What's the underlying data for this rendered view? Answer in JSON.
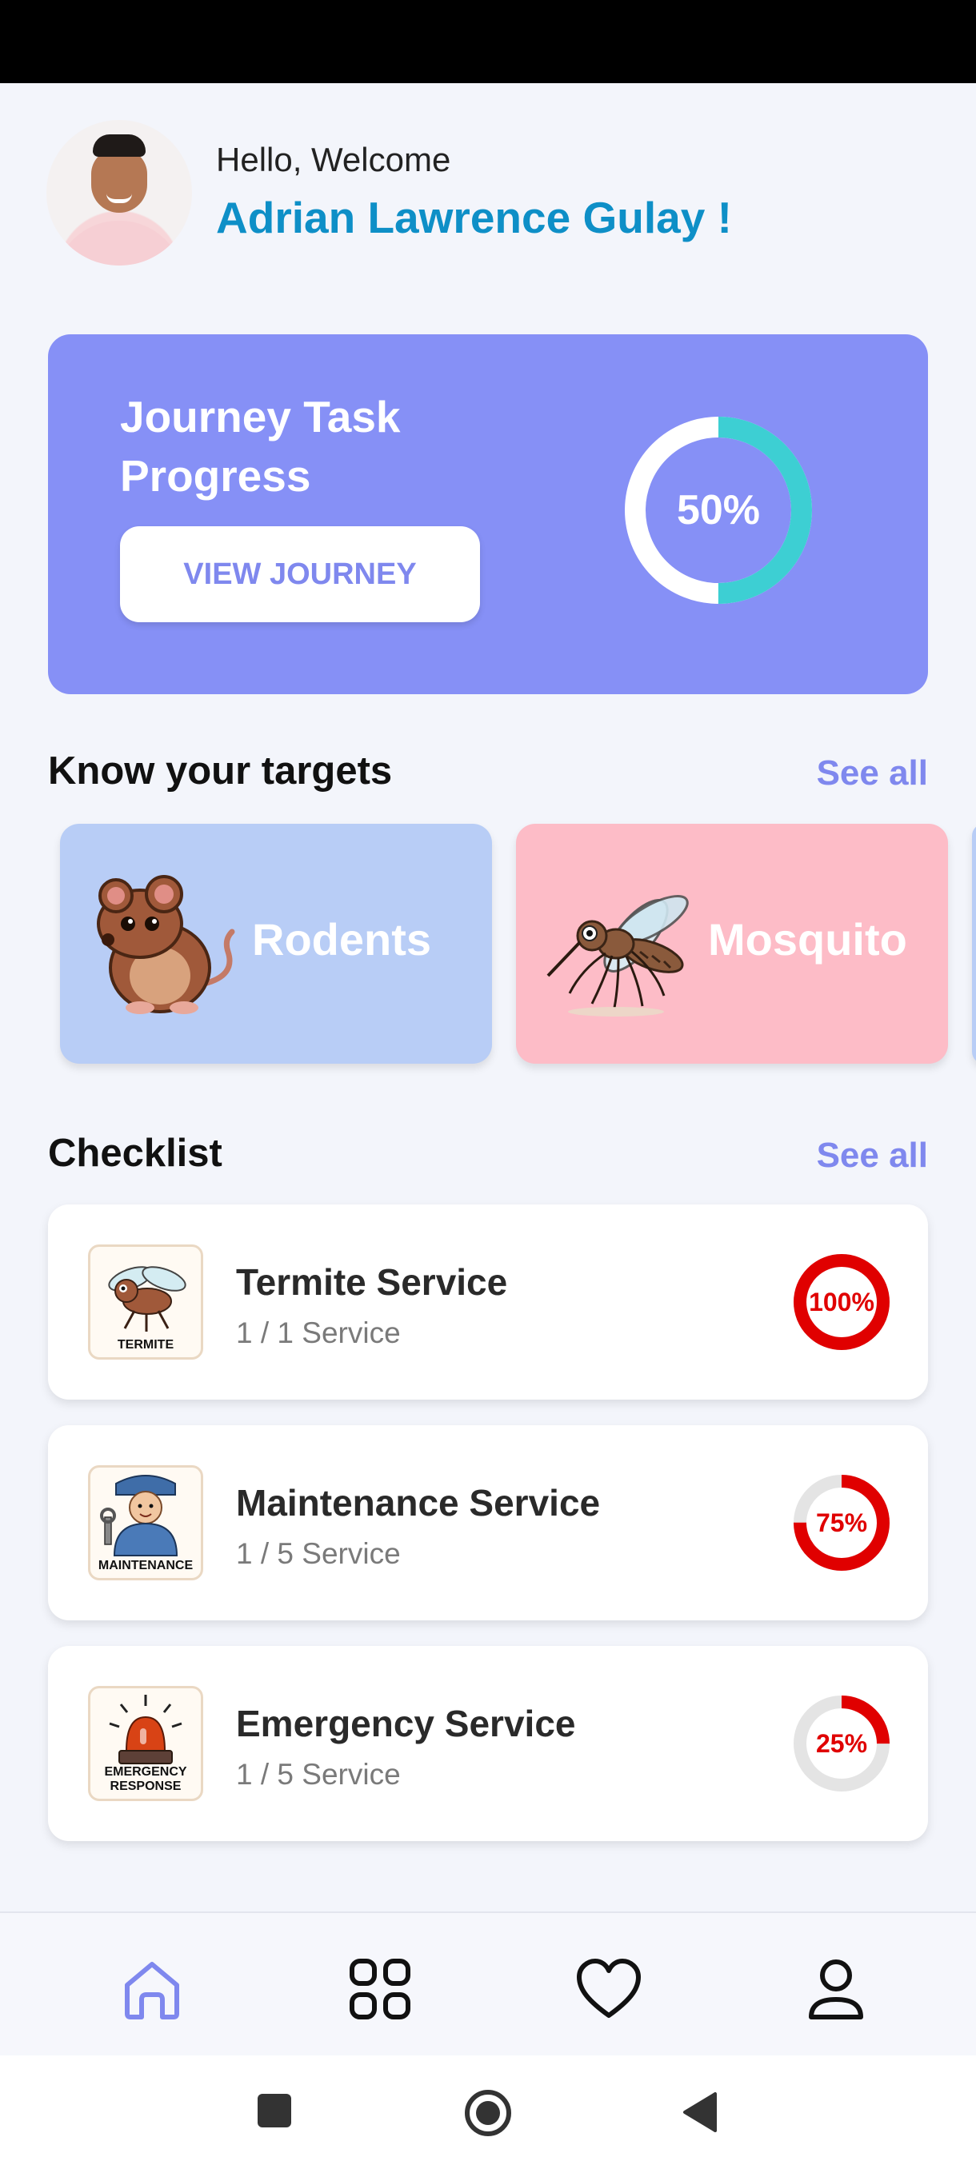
{
  "header": {
    "greeting": "Hello, Welcome",
    "user_name": "Adrian Lawrence Gulay !"
  },
  "journey": {
    "title": "Journey Task Progress",
    "button_label": "VIEW JOURNEY",
    "progress_label": "50%",
    "progress": 0.5
  },
  "targets": {
    "title": "Know your targets",
    "see_all": "See all",
    "items": [
      {
        "label": "Rodents",
        "icon": "rodent-icon"
      },
      {
        "label": "Mosquito",
        "icon": "mosquito-icon"
      }
    ]
  },
  "checklist": {
    "title": "Checklist",
    "see_all": "See all",
    "items": [
      {
        "name": "Termite Service",
        "sub": "1 / 1 Service",
        "percent_label": "100%",
        "progress": 1.0,
        "caption": "TERMITE"
      },
      {
        "name": "Maintenance Service",
        "sub": "1 / 5 Service",
        "percent_label": "75%",
        "progress": 0.75,
        "caption": "MAINTENANCE"
      },
      {
        "name": "Emergency Service",
        "sub": "1 / 5 Service",
        "percent_label": "25%",
        "progress": 0.25,
        "caption": "EMERGENCY RESPONSE"
      }
    ]
  },
  "nav": {
    "items": [
      "home-icon",
      "apps-grid-icon",
      "heart-icon",
      "profile-icon"
    ],
    "active": "home-icon"
  },
  "colors": {
    "accent": "#7f88ee",
    "card_bg": "#8690f6",
    "name_blue": "#0e8fc7",
    "ring_teal": "#3dcfd3",
    "ring_red": "#e00000"
  }
}
